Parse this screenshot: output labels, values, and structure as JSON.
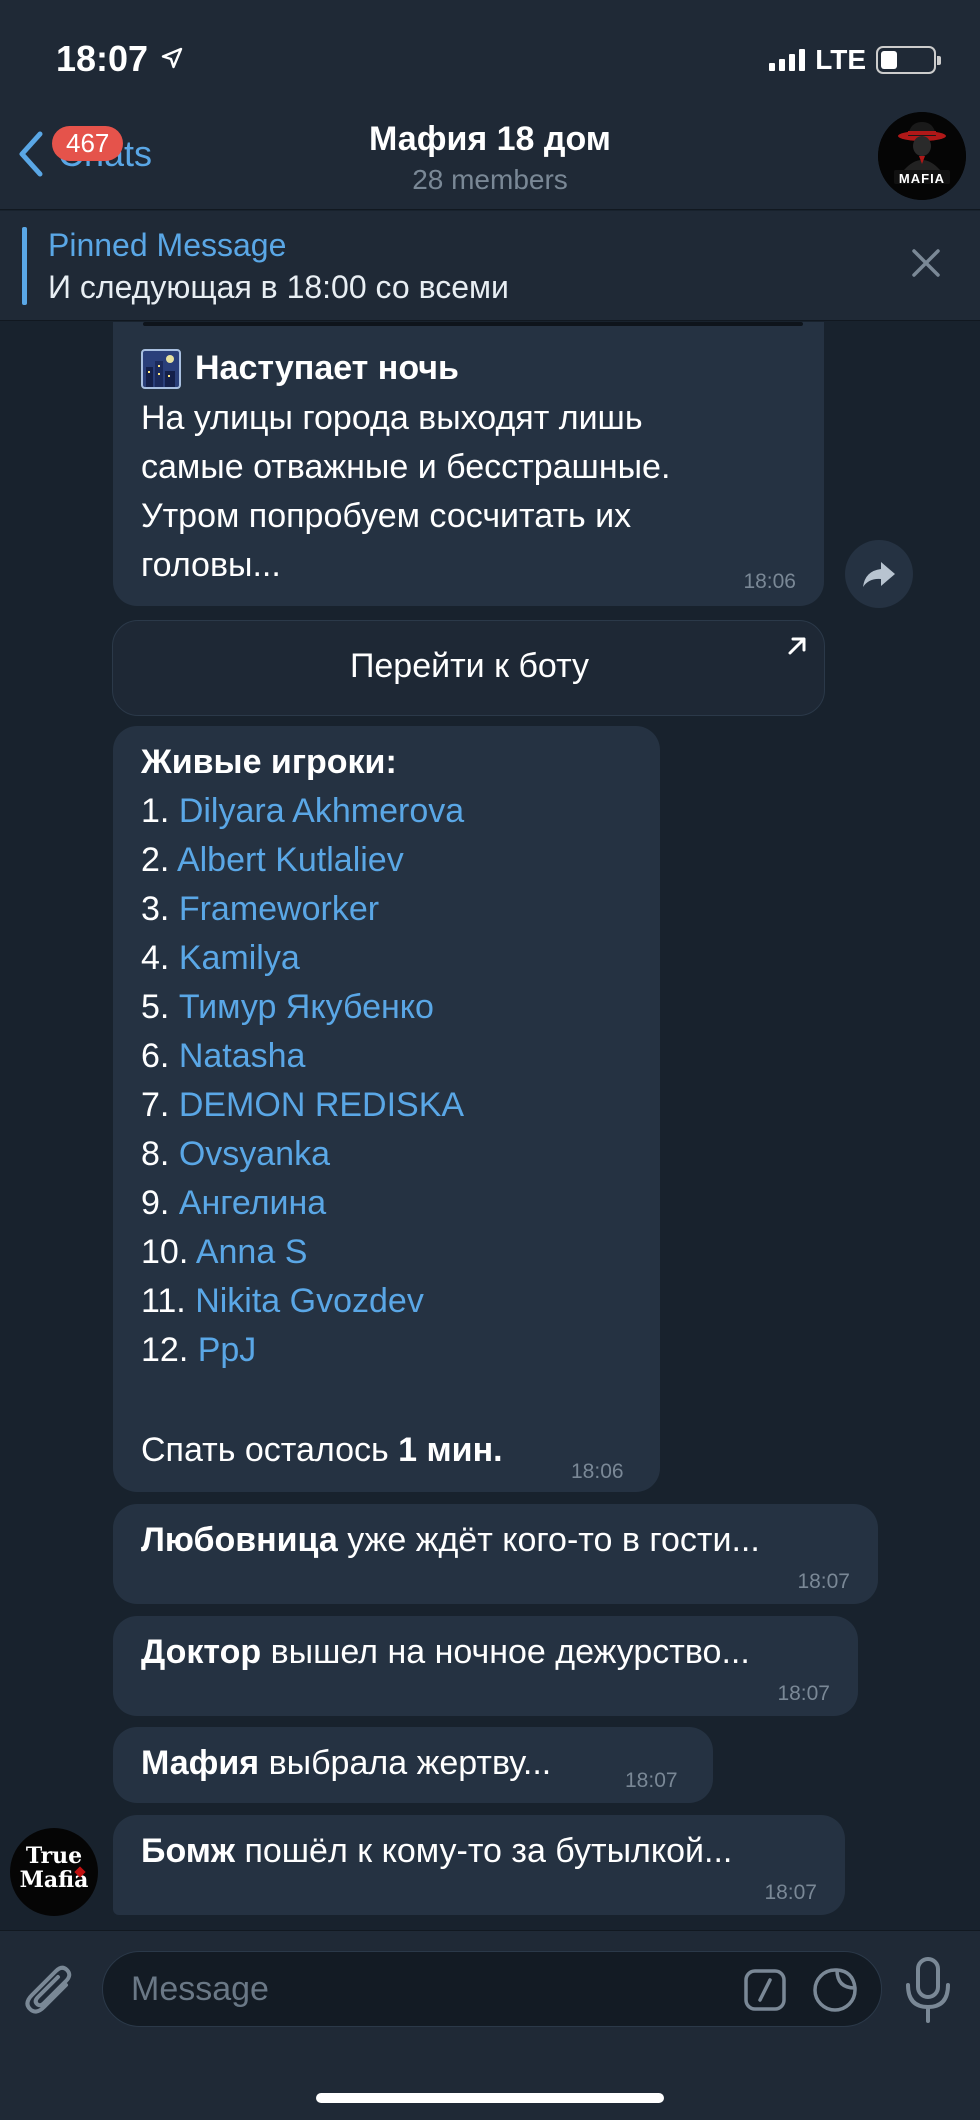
{
  "status": {
    "time": "18:07",
    "network": "LTE"
  },
  "header": {
    "back_label": "Chats",
    "unread_badge": "467",
    "title": "Мафия 18 дом",
    "subtitle": "28 members",
    "avatar_text": "MAFIA"
  },
  "pinned": {
    "title": "Pinned Message",
    "text": "И следующая в 18:00 со всеми"
  },
  "messages": {
    "night": {
      "title": "Наступает ночь",
      "line1": "На улицы города выходят лишь",
      "line2": "самые отважные и бесстрашные.",
      "line3": "Утром попробуем сосчитать их",
      "line4": "головы...",
      "time": "18:06"
    },
    "bot_button": "Перейти к боту",
    "players": {
      "title": "Живые игроки:",
      "list": [
        {
          "num": "1.",
          "name": "Dilyara Akhmerova"
        },
        {
          "num": "2.",
          "name": "Albert Kutlaliev"
        },
        {
          "num": "3.",
          "name": "Frameworker"
        },
        {
          "num": "4.",
          "name": "Kamilya"
        },
        {
          "num": "5.",
          "name": "Тимур Якубенко"
        },
        {
          "num": "6.",
          "name": "Natasha"
        },
        {
          "num": "7.",
          "name": "DEMON REDISKA"
        },
        {
          "num": "8.",
          "name": "Ovsyanka"
        },
        {
          "num": "9.",
          "name": "Ангелина"
        },
        {
          "num": "10.",
          "name": "Anna S"
        },
        {
          "num": "11.",
          "name": "Nikita Gvozdev"
        },
        {
          "num": "12.",
          "name": "PpJ"
        }
      ],
      "sleep_prefix": "Спать осталось",
      "sleep_value": "1 мин.",
      "time": "18:06"
    },
    "m1": {
      "bold": "Любовница",
      "rest": " уже ждёт кого-то в гости...",
      "time": "18:07"
    },
    "m2": {
      "bold": "Доктор",
      "rest": " вышел на ночное дежурство...",
      "time": "18:07"
    },
    "m3": {
      "bold": "Мафия",
      "rest": " выбрала жертву...",
      "time": "18:07"
    },
    "m4": {
      "bold": "Бомж",
      "rest": " пошёл к кому-то за бутылкой...",
      "time": "18:07"
    },
    "sender_avatar_line1": "True",
    "sender_avatar_line2": "Mafia"
  },
  "composer": {
    "placeholder": "Message"
  }
}
